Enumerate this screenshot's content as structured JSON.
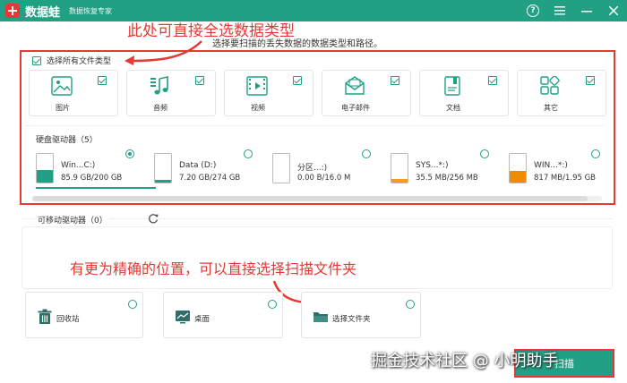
{
  "titlebar": {
    "app_name": "数据蛙",
    "subtitle": "数据恢复专家"
  },
  "annotations": {
    "top": "此处可直接全选数据类型",
    "middle": "有更为精确的位置，可以直接选择扫描文件夹"
  },
  "instruction": "选择要扫描的丢失数据的数据类型和路径。",
  "select_all_label": "选择所有文件类型",
  "file_types": [
    {
      "label": "图片",
      "icon": "image-icon"
    },
    {
      "label": "音频",
      "icon": "music-icon"
    },
    {
      "label": "视频",
      "icon": "video-icon"
    },
    {
      "label": "电子邮件",
      "icon": "email-icon"
    },
    {
      "label": "文档",
      "icon": "document-icon"
    },
    {
      "label": "其它",
      "icon": "other-icon"
    }
  ],
  "hard_drives": {
    "title": "硬盘驱动器（5）",
    "drives": [
      {
        "name": "Win...C:)",
        "size": "85.9 GB/200 GB",
        "color": "#21a084",
        "used": 0.43
      },
      {
        "name": "Data (D:)",
        "size": "7.20 GB/274 GB",
        "color": "#21a084",
        "used": 0.03
      },
      {
        "name": "分区...:)",
        "size": "0.00  B/16.0 M",
        "color": "#f59c1a",
        "used": 0.0
      },
      {
        "name": "SYS...*:)",
        "size": "35.5 MB/256 MB",
        "color": "#f59c1a",
        "used": 0.14
      },
      {
        "name": "WIN...*:)",
        "size": "817 MB/1.95 GB",
        "color": "#f08c00",
        "used": 0.42
      }
    ]
  },
  "removable": {
    "title": "可移动驱动器（0）"
  },
  "locations": [
    {
      "label": "回收站",
      "icon": "recycle-bin-icon"
    },
    {
      "label": "桌面",
      "icon": "desktop-icon"
    },
    {
      "label": "选择文件夹",
      "icon": "folder-icon"
    }
  ],
  "scan_label": "扫描",
  "watermark": "掘金技术社区 @ 小明助手"
}
